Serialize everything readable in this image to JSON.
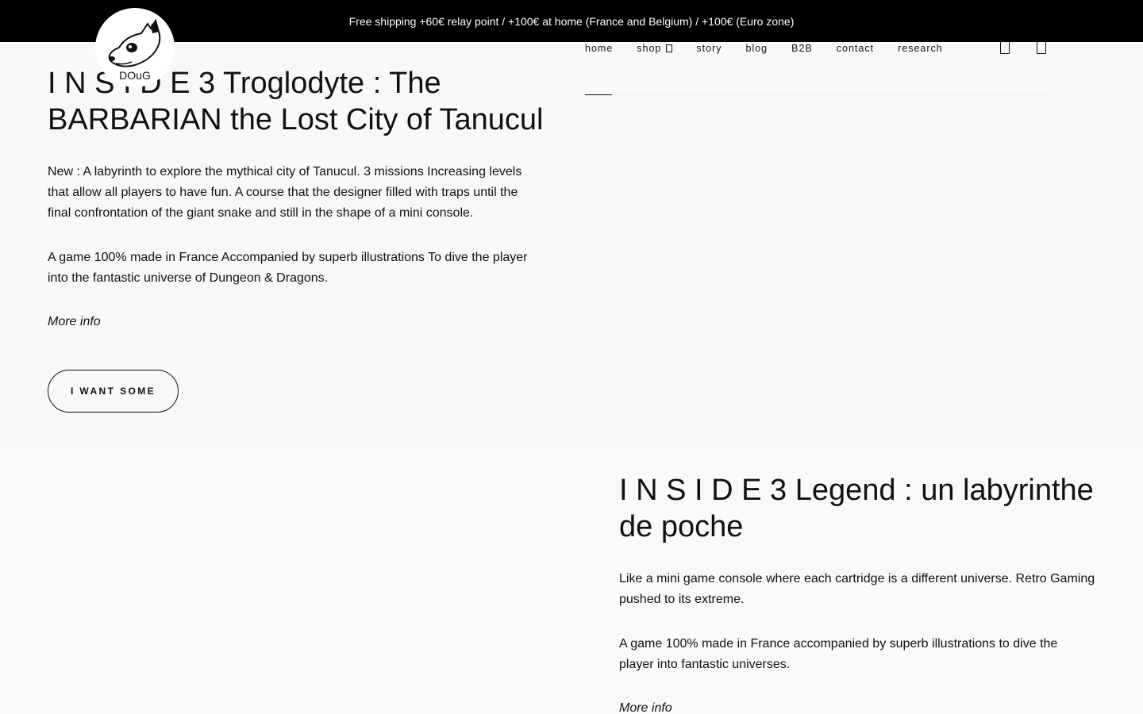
{
  "announcement": "Free shipping +60€ relay point / +100€ at home (France and Belgium) / +100€ (Euro zone)",
  "logo": {
    "text": "DOuG",
    "icon": "bull-terrier-dog-logo"
  },
  "nav": {
    "items": [
      {
        "label": "home",
        "active": true
      },
      {
        "label": "shop",
        "has_dropdown": true
      },
      {
        "label": "story"
      },
      {
        "label": "blog"
      },
      {
        "label": "B2B"
      },
      {
        "label": "contact"
      },
      {
        "label": "research"
      }
    ],
    "icons": [
      "account-icon",
      "cart-icon"
    ]
  },
  "product1": {
    "title": "I N S I D E 3 Troglodyte : The BARBARIAN the Lost City of Tanucul",
    "desc1": "New : A labyrinth to explore the mythical city of Tanucul. 3 missions Increasing levels that allow all players to have fun. A course that the designer filled with traps until the final confrontation of the giant snake and still in the shape of a mini console.",
    "desc2": "A game 100% made in France Accompanied by superb illustrations To dive the player into the fantastic universe of Dungeon & Dragons.",
    "more": "More info",
    "cta": "I WANT SOME"
  },
  "product2": {
    "title": "I N S I D E 3 Legend : un labyrinthe de poche",
    "desc1": "Like a mini game console where each cartridge is a different universe. Retro Gaming pushed to its extreme.",
    "desc2": "A game 100% made in France accompanied by superb illustrations to dive the player into fantastic universes.",
    "more": "More info"
  },
  "colors": {
    "topbar": "#000000",
    "background": "#f8f8f8",
    "text": "#111111"
  }
}
